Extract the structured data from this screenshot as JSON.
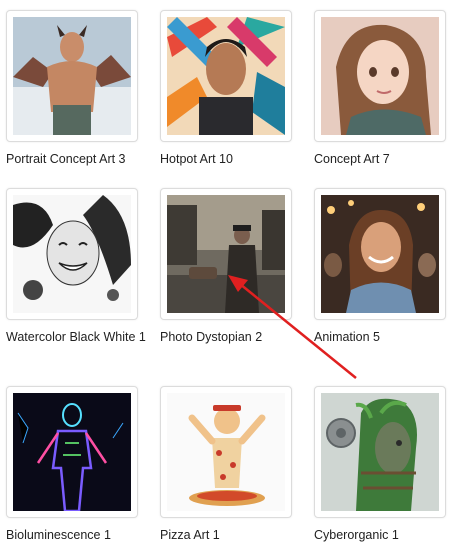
{
  "gallery": {
    "items": [
      {
        "label": "Portrait Concept Art 3",
        "image": "demon-warrior-portrait"
      },
      {
        "label": "Hotpot Art 10",
        "image": "pop-art-man-portrait"
      },
      {
        "label": "Concept Art 7",
        "image": "anime-girl-portrait"
      },
      {
        "label": "Watercolor Black White 1",
        "image": "ink-smiling-woman"
      },
      {
        "label": "Photo Dystopian 2",
        "image": "dystopian-street-man"
      },
      {
        "label": "Animation 5",
        "image": "animated-woman-smiling"
      },
      {
        "label": "Bioluminescence 1",
        "image": "glowing-figure"
      },
      {
        "label": "Pizza Art 1",
        "image": "pizza-character"
      },
      {
        "label": "Cyberorganic 1",
        "image": "mechanical-plant-man"
      }
    ]
  },
  "annotation": {
    "arrow_color": "#e02020",
    "icon": "red-arrow-pointer"
  }
}
